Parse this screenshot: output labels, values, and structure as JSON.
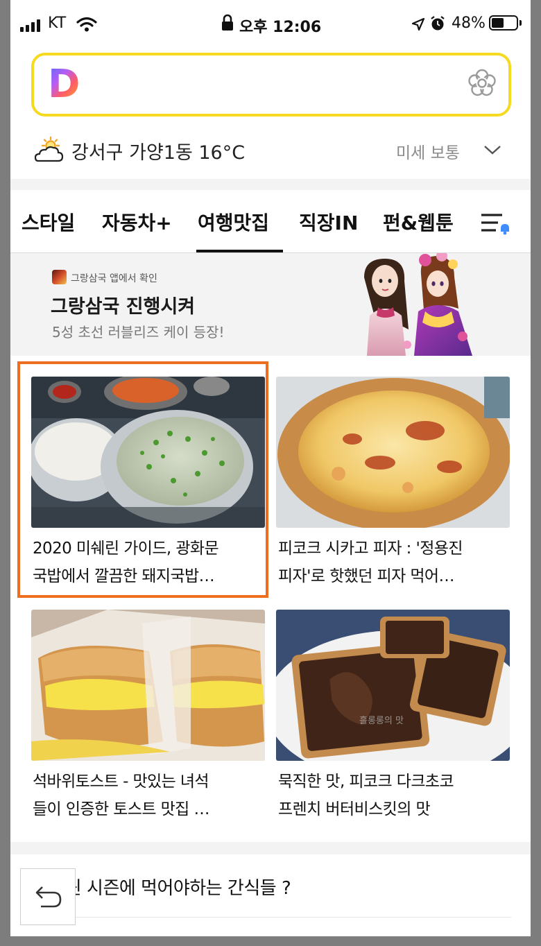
{
  "status_bar": {
    "carrier": "KT",
    "time": "오후 12:06",
    "battery": "48%",
    "battery_level": 0.48
  },
  "search": {
    "logo_letter": "D",
    "logo_icon": "daum-logo-icon",
    "flower_icon": "flower-icon"
  },
  "weather": {
    "icon": "partly-cloudy-icon",
    "location_temp": "강서구 가양1동 16°C",
    "dust": "미세 보통"
  },
  "tabs": [
    {
      "label": "스타일"
    },
    {
      "label": "자동차+"
    },
    {
      "label": "여행맛집",
      "active": true
    },
    {
      "label": "직장IN"
    },
    {
      "label": "펀&웹툰"
    }
  ],
  "banner": {
    "source": "그랑삼국 앱에서 확인",
    "title": "그랑삼국 진행시켜",
    "subtitle": "5성 초선 러블리즈 케이 등장!"
  },
  "cards": [
    {
      "line1": "2020 미쉐린 가이드, 광화문",
      "line2": "국밥에서 깔끔한 돼지국밥…",
      "image": "gukbap-photo"
    },
    {
      "line1": "피코크 시카고 피자 : '정용진",
      "line2": "피자'로 핫했던 피자 먹어…",
      "image": "pizza-photo"
    },
    {
      "line1": "석바위토스트 - 맛있는 녀석",
      "line2": "들이 인증한 토스트 맛집 …",
      "image": "toast-photo"
    },
    {
      "line1": "묵직한 맛, 피코크 다크초코",
      "line2": "프렌치 버터비스킷의 맛",
      "image": "biscuit-photo",
      "watermark": "흘롱롱의 맛"
    }
  ],
  "next_article": {
    "title": "할로윈 시즌에 먹어야하는 간식들 ?"
  },
  "colors": {
    "search_border": "#f5da1f",
    "highlight": "#ee6e1f",
    "bell_badge": "#3f8cff"
  }
}
